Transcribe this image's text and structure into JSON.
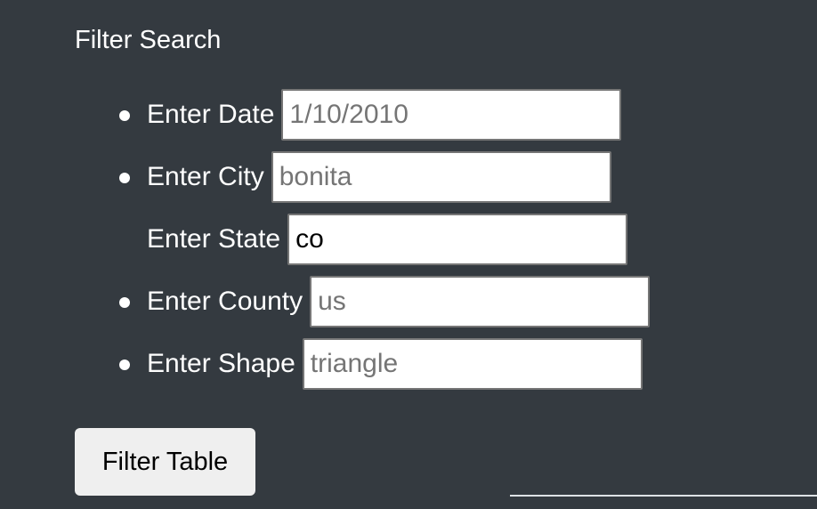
{
  "form": {
    "heading": "Filter Search",
    "fields": [
      {
        "label": "Enter Date",
        "value": "",
        "placeholder": "1/10/2010",
        "bulleted": true
      },
      {
        "label": "Enter City",
        "value": "",
        "placeholder": "bonita",
        "bulleted": true
      },
      {
        "label": "Enter State",
        "value": "co",
        "placeholder": "",
        "bulleted": false
      },
      {
        "label": "Enter County",
        "value": "",
        "placeholder": "us",
        "bulleted": true
      },
      {
        "label": "Enter Shape",
        "value": "",
        "placeholder": "triangle",
        "bulleted": true
      }
    ],
    "submit_label": "Filter Table"
  },
  "colors": {
    "background": "#343a40",
    "text": "#ffffff",
    "button_background": "#efefef",
    "input_border": "#767676"
  }
}
